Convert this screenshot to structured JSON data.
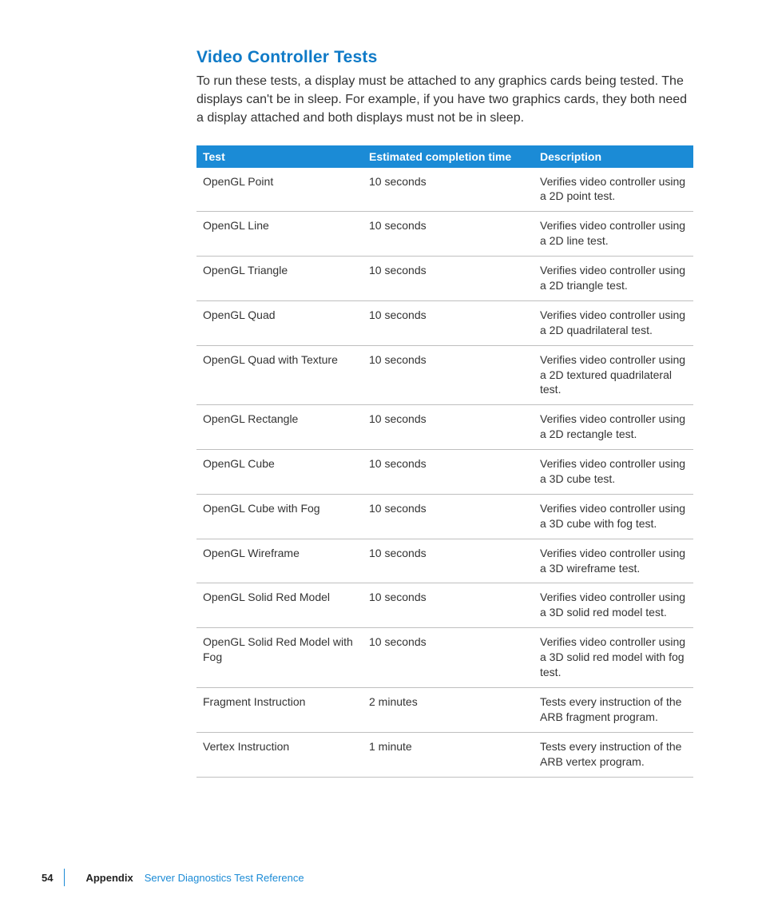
{
  "section": {
    "title": "Video Controller Tests",
    "intro": "To run these tests, a display must be attached to any graphics cards being tested. The displays can't be in sleep. For example, if you have two graphics cards, they both need a display attached and both displays must not be in sleep."
  },
  "table": {
    "headers": {
      "test": "Test",
      "time": "Estimated completion time",
      "desc": "Description"
    },
    "rows": [
      {
        "test": "OpenGL Point",
        "time": "10 seconds",
        "desc": "Verifies video controller using a 2D point test."
      },
      {
        "test": "OpenGL Line",
        "time": "10 seconds",
        "desc": "Verifies video controller using a 2D line test."
      },
      {
        "test": "OpenGL Triangle",
        "time": "10 seconds",
        "desc": "Verifies video controller using a 2D triangle test."
      },
      {
        "test": "OpenGL Quad",
        "time": "10 seconds",
        "desc": "Verifies video controller using a 2D quadrilateral test."
      },
      {
        "test": "OpenGL Quad with Texture",
        "time": "10 seconds",
        "desc": "Verifies video controller using a 2D textured quadrilateral test."
      },
      {
        "test": "OpenGL Rectangle",
        "time": "10 seconds",
        "desc": "Verifies video controller using a 2D rectangle test."
      },
      {
        "test": "OpenGL Cube",
        "time": "10 seconds",
        "desc": "Verifies video controller using a 3D cube test."
      },
      {
        "test": "OpenGL Cube with Fog",
        "time": "10 seconds",
        "desc": "Verifies video controller using a 3D cube with fog test."
      },
      {
        "test": "OpenGL Wireframe",
        "time": "10 seconds",
        "desc": "Verifies video controller using a 3D wireframe test."
      },
      {
        "test": "OpenGL Solid Red Model",
        "time": "10 seconds",
        "desc": "Verifies video controller using a 3D solid red model test."
      },
      {
        "test": "OpenGL Solid Red Model with Fog",
        "time": "10 seconds",
        "desc": "Verifies video controller using a 3D solid red model with fog test."
      },
      {
        "test": "Fragment Instruction",
        "time": "2 minutes",
        "desc": "Tests every instruction of the ARB fragment program."
      },
      {
        "test": "Vertex Instruction",
        "time": "1 minute",
        "desc": "Tests every instruction of the ARB vertex program."
      }
    ]
  },
  "footer": {
    "page": "54",
    "appendix": "Appendix",
    "crumb": "Server Diagnostics Test Reference"
  }
}
